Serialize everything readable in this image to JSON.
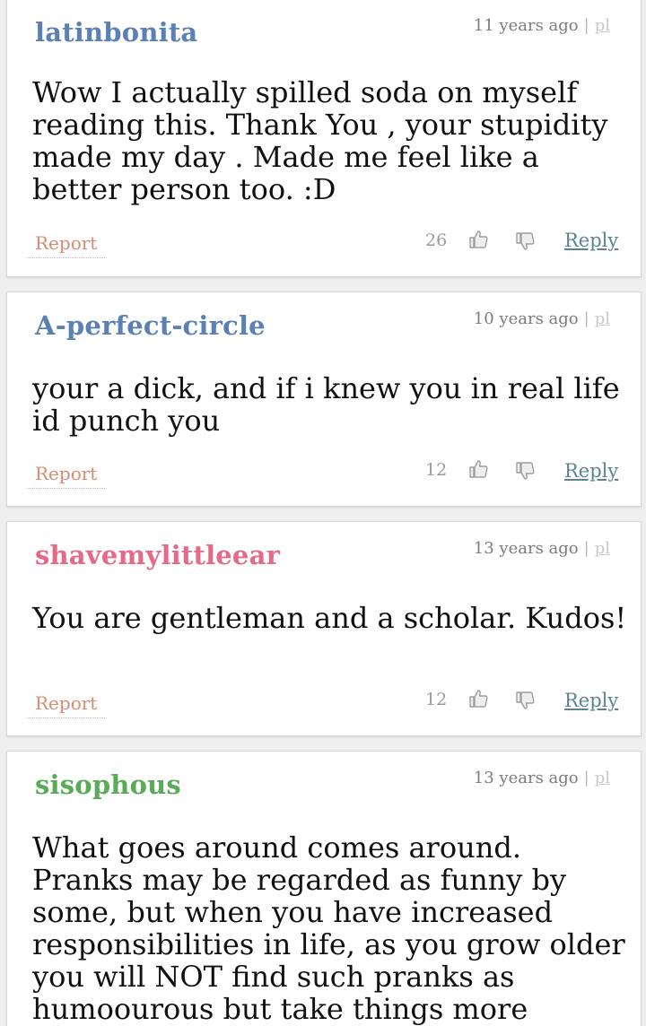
{
  "comments": [
    {
      "username": "latinbonita",
      "username_color": "#5b80b4",
      "time": "11 years ago",
      "sep": "|",
      "pl": "pl",
      "text": "Wow I actually spilled soda on myself reading this. Thank You , your stupidity made my day . Made me feel like a better person too. :D",
      "report": "Report",
      "score": "26",
      "reply": "Reply"
    },
    {
      "username": "A-perfect-circle",
      "username_color": "#5b80b4",
      "time": "10 years ago",
      "sep": "|",
      "pl": "pl",
      "text": "your a dick, and if i knew you in real life id punch you",
      "report": "Report",
      "score": "12",
      "reply": "Reply"
    },
    {
      "username": "shavemylittleear",
      "username_color": "#e46a8a",
      "time": "13 years ago",
      "sep": "|",
      "pl": "pl",
      "text": "You are gentleman and a scholar. Kudos!",
      "report": "Report",
      "score": "12",
      "reply": "Reply"
    },
    {
      "username": "sisophous",
      "username_color": "#5aab58",
      "time": "13 years ago",
      "sep": "|",
      "pl": "pl",
      "text": "What goes around comes around. Pranks may be regarded as funny by some, but when you have increased responsibilities in life, as you grow older you will NOT find such pranks as humoourous but take things more",
      "report": "",
      "score": "",
      "reply": ""
    }
  ]
}
